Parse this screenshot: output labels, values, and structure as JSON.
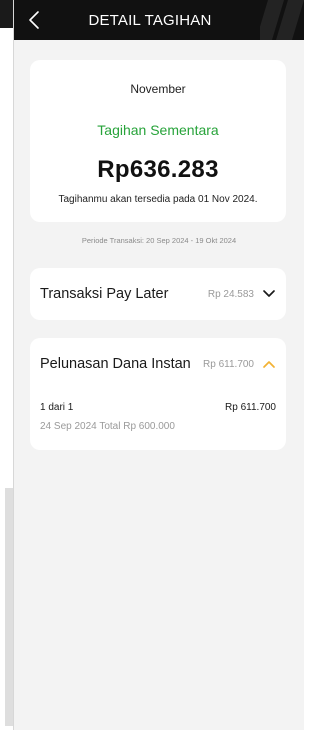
{
  "header": {
    "title": "DETAIL TAGIHAN"
  },
  "summary": {
    "month": "November",
    "status": "Tagihan Sementara",
    "amount": "Rp636.283",
    "note": "Tagihanmu akan tersedia pada 01 Nov 2024."
  },
  "period": "Periode Transaksi: 20 Sep 2024 - 19 Okt 2024",
  "rows": [
    {
      "title": "Transaksi Pay Later",
      "amount": "Rp 24.583",
      "icon": "chevron-down-icon",
      "expanded": false
    },
    {
      "title": "Pelunasan Dana Instan",
      "amount": "Rp 611.700",
      "icon": "chevron-up-icon",
      "expanded": true,
      "detail": {
        "installment": "1 dari 1",
        "installment_amount": "Rp 611.700",
        "info": "24 Sep 2024 Total Rp 600.000"
      }
    }
  ],
  "colors": {
    "status_green": "#27a33a",
    "chevron_orange": "#f2b233",
    "header_bg": "#111111",
    "page_bg": "#f3f3f3"
  }
}
